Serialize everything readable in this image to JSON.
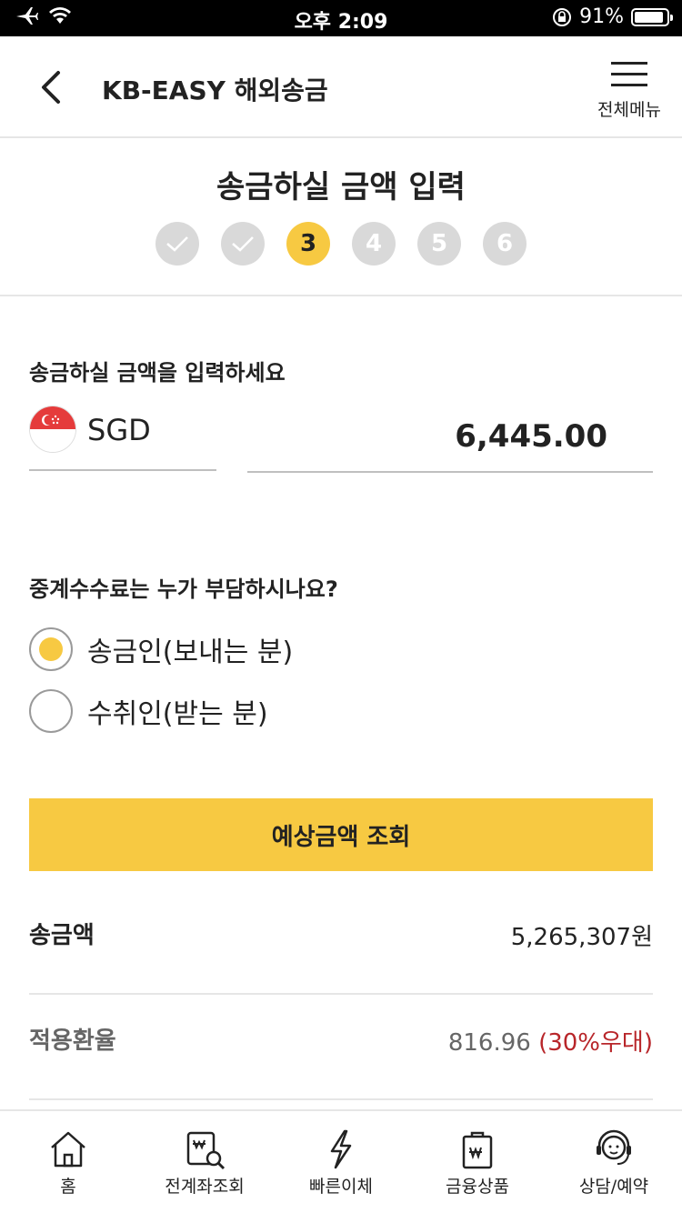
{
  "status_bar": {
    "time": "오후 2:09",
    "battery_text": "91%",
    "battery_level": 0.91
  },
  "header": {
    "title": "KB-EASY 해외송금",
    "menu_label": "전체메뉴"
  },
  "stepper": {
    "title": "송금하실 금액 입력",
    "steps": [
      {
        "label": "",
        "state": "done"
      },
      {
        "label": "",
        "state": "done"
      },
      {
        "label": "3",
        "state": "active"
      },
      {
        "label": "4",
        "state": "pending"
      },
      {
        "label": "5",
        "state": "pending"
      },
      {
        "label": "6",
        "state": "pending"
      }
    ]
  },
  "amount_section": {
    "label": "송금하실 금액을 입력하세요",
    "currency_code": "SGD",
    "amount": "6,445.00"
  },
  "fee_section": {
    "label": "중계수수료는 누가 부담하시나요?",
    "options": [
      {
        "label": "송금인(보내는 분)",
        "selected": true
      },
      {
        "label": "수취인(받는 분)",
        "selected": false
      }
    ]
  },
  "estimate_button": {
    "label": "예상금액 조회"
  },
  "results": {
    "send_amount_label": "송금액",
    "send_amount_value": "5,265,307원",
    "rate_label": "적용환율",
    "rate_value": "816.96",
    "rate_discount": "(30%우대)"
  },
  "tabbar": {
    "items": [
      {
        "label": "홈",
        "icon": "home-icon"
      },
      {
        "label": "전계좌조회",
        "icon": "account-search-icon"
      },
      {
        "label": "빠른이체",
        "icon": "lightning-icon"
      },
      {
        "label": "금융상품",
        "icon": "product-bag-icon"
      },
      {
        "label": "상담/예약",
        "icon": "headset-icon"
      }
    ]
  },
  "colors": {
    "accent": "#f7c942",
    "discount": "#b8262a",
    "inactive_step": "#d9d9d9"
  }
}
